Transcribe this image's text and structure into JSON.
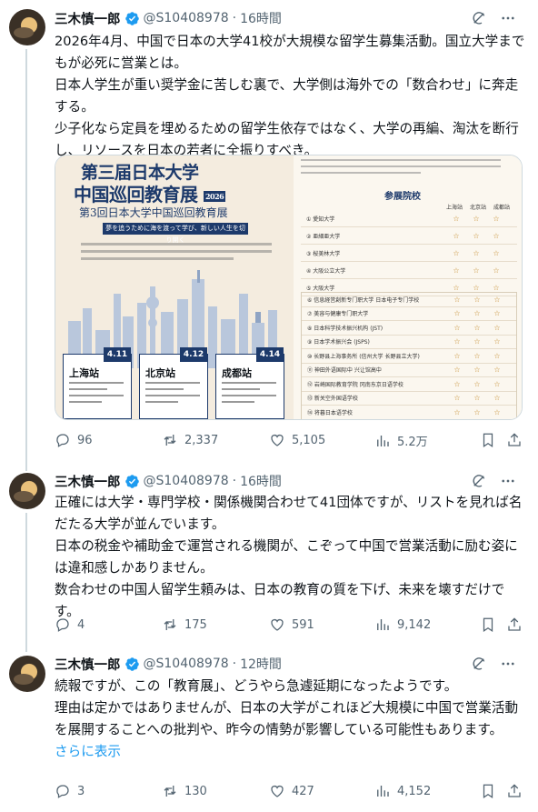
{
  "tweets": [
    {
      "name": "三木慎一郎",
      "handle": "@S10408978",
      "dot": "·",
      "time": "16時間",
      "text": [
        "2026年4月、中国で日本の大学41校が大規模な留学生募集活動。国立大学までもが必死に営業とは。",
        "日本人学生が重い奨学金に苦しむ裏で、大学側は海外での「数合わせ」に奔走する。",
        "少子化なら定員を埋めるための留学生依存ではなく、大学の再編、淘汰を断行し、リソースを日本の若者に全振りすべき。"
      ],
      "replies": "96",
      "reposts": "2,337",
      "likes": "5,105",
      "views": "5.2万",
      "media": {
        "title_line1": "第三届日本大学",
        "title_line2": "中国巡回教育展",
        "badge": "2026",
        "subtitle": "第3回日本大学中国巡回教育展",
        "banner": "夢を追うために海を渡って学び、新しい人生を切り開く",
        "stations": [
          {
            "date": "4.11",
            "city": "上海站"
          },
          {
            "date": "4.12",
            "city": "北京站"
          },
          {
            "date": "4.14",
            "city": "成都站"
          }
        ],
        "list_title": "参展院校",
        "cities": [
          "上海站",
          "北京站",
          "成都站"
        ],
        "schools_a": [
          "① 愛知大学",
          "② 亜細亜大学",
          "③ 桜美林大学",
          "④ 大阪公立大学",
          "⑤ 大阪大学"
        ],
        "schools_b": [
          "⑥ 信息経営創新专门职大学 日本电子专门学校",
          "⑦ 美容与健康专门职大学",
          "⑧ 日本科学技术振兴机构 (JST)",
          "⑨ 日本学术振兴会 (JSPS)",
          "⑩ 长野县上海事务所 (信州大学 长野县立大学)",
          "⑪ 神田外语国际中 兴让馆高中",
          "⑫ 岩崎国际教育学院 冈南东京日语学校",
          "⑬ 新关空外国语学校",
          "⑭ 将暮日本语学校"
        ]
      }
    },
    {
      "name": "三木慎一郎",
      "handle": "@S10408978",
      "dot": "·",
      "time": "16時間",
      "text": [
        "正確には大学・専門学校・関係機関合わせて41団体ですが、リストを見れば名だたる大学が並んでいます。",
        "日本の税金や補助金で運営される機関が、こぞって中国で営業活動に励む姿には違和感しかありません。",
        "数合わせの中国人留学生頼みは、日本の教育の質を下げ、未来を壊すだけです。"
      ],
      "replies": "4",
      "reposts": "175",
      "likes": "591",
      "views": "9,142"
    },
    {
      "name": "三木慎一郎",
      "handle": "@S10408978",
      "dot": "·",
      "time": "12時間",
      "text": [
        "続報ですが、この「教育展」、どうやら急遽延期になったようです。",
        "理由は定かではありませんが、日本の大学がこれほど大規模に中国で営業活動を展開することへの批判や、昨今の情勢が影響している可能性もあります。"
      ],
      "show_more": "さらに表示",
      "replies": "3",
      "reposts": "130",
      "likes": "427",
      "views": "4,152"
    }
  ],
  "colors": {
    "text": "#0f1419",
    "secondary": "#536471",
    "link": "#1d9bf0",
    "verified": "#1d9bf0"
  },
  "icons": [
    "verified-badge-icon",
    "grok-icon",
    "more-icon",
    "reply-icon",
    "repost-icon",
    "like-icon",
    "views-icon",
    "bookmark-icon",
    "share-icon"
  ]
}
